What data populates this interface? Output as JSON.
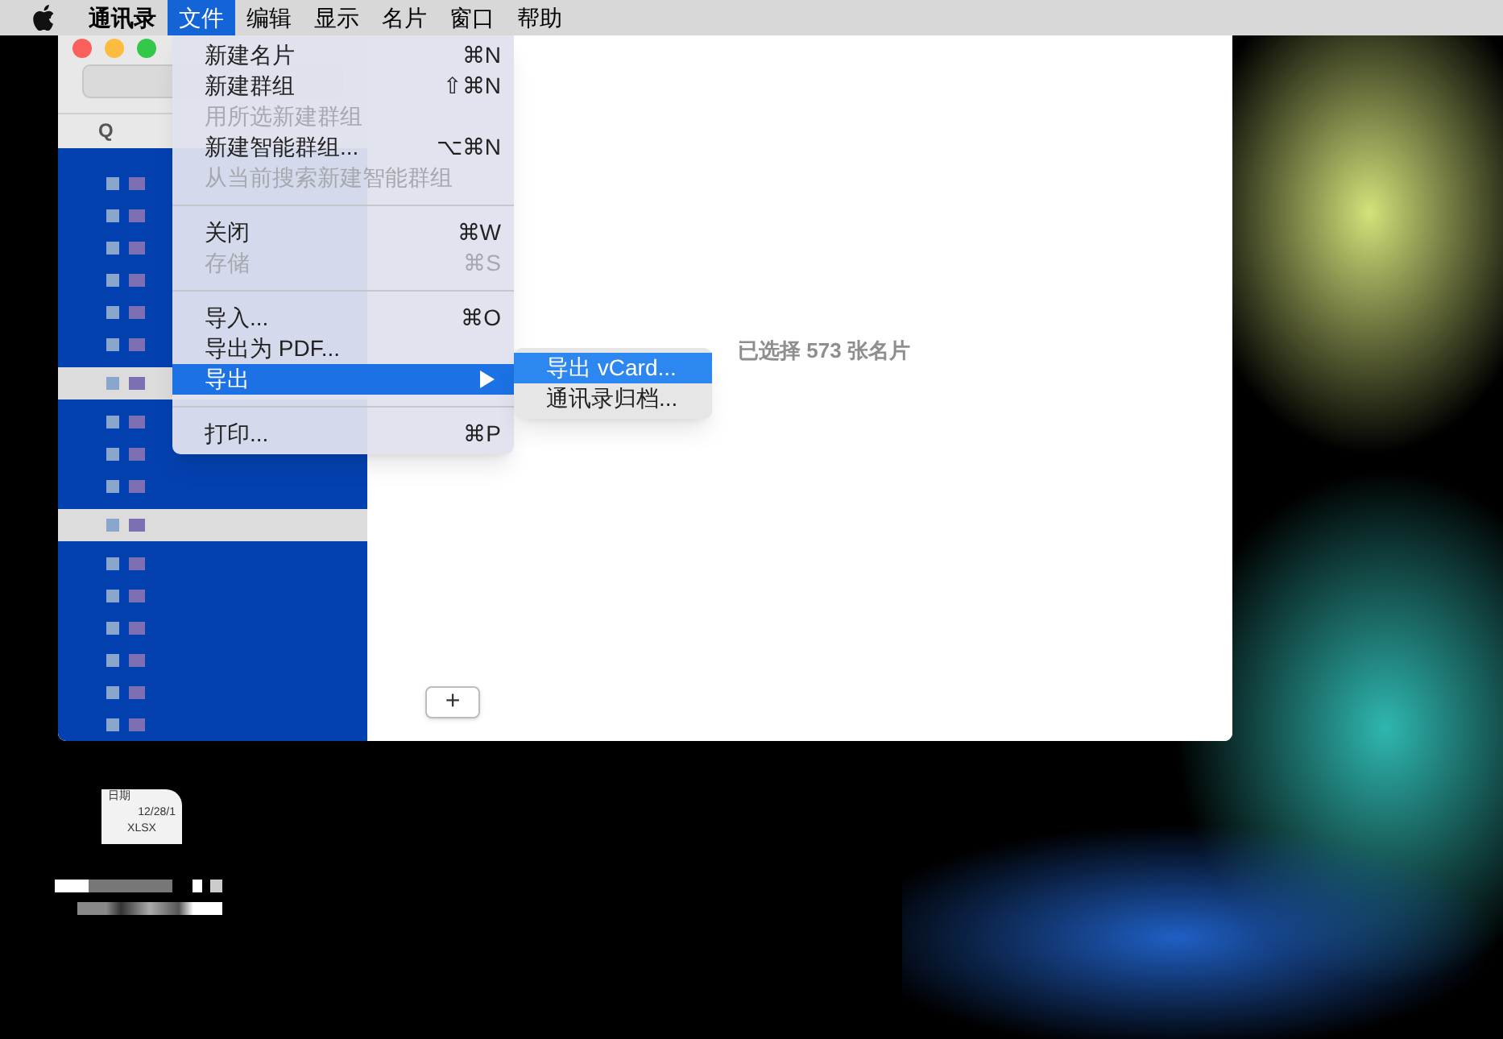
{
  "menu_bar": {
    "items": [
      {
        "label": "通讯录",
        "selected": false,
        "bold": true
      },
      {
        "label": "文件",
        "selected": true,
        "bold": false
      },
      {
        "label": "编辑",
        "selected": false,
        "bold": false
      },
      {
        "label": "显示",
        "selected": false,
        "bold": false
      },
      {
        "label": "名片",
        "selected": false,
        "bold": false
      },
      {
        "label": "窗口",
        "selected": false,
        "bold": false
      },
      {
        "label": "帮助",
        "selected": false,
        "bold": false
      }
    ]
  },
  "file_menu": {
    "items": [
      {
        "kind": "item",
        "label": "新建名片",
        "shortcut": "⌘N",
        "disabled": false,
        "selected": false,
        "submenu": false
      },
      {
        "kind": "item",
        "label": "新建群组",
        "shortcut": "⇧⌘N",
        "disabled": false,
        "selected": false,
        "submenu": false
      },
      {
        "kind": "item",
        "label": "用所选新建群组",
        "disabled": true,
        "selected": false,
        "submenu": false
      },
      {
        "kind": "item",
        "label": "新建智能群组...",
        "shortcut": "⌥⌘N",
        "disabled": false,
        "selected": false,
        "submenu": false
      },
      {
        "kind": "item",
        "label": "从当前搜索新建智能群组",
        "disabled": true,
        "selected": false,
        "submenu": false
      },
      {
        "kind": "separator"
      },
      {
        "kind": "item",
        "label": "关闭",
        "shortcut": "⌘W",
        "disabled": false,
        "selected": false,
        "submenu": false
      },
      {
        "kind": "item",
        "label": "存储",
        "shortcut": "⌘S",
        "disabled": true,
        "selected": false,
        "submenu": false
      },
      {
        "kind": "separator"
      },
      {
        "kind": "item",
        "label": "导入...",
        "shortcut": "⌘O",
        "disabled": false,
        "selected": false,
        "submenu": false
      },
      {
        "kind": "item",
        "label": "导出为 PDF...",
        "disabled": false,
        "selected": false,
        "submenu": false
      },
      {
        "kind": "item",
        "label": "导出",
        "disabled": false,
        "selected": true,
        "submenu": true
      },
      {
        "kind": "separator"
      },
      {
        "kind": "item",
        "label": "打印...",
        "shortcut": "⌘P",
        "disabled": false,
        "selected": false,
        "submenu": false
      }
    ]
  },
  "export_submenu": {
    "items": [
      {
        "label": "导出 vCard...",
        "selected": true
      },
      {
        "label": "通讯录归档...",
        "selected": false
      }
    ]
  },
  "contacts_window": {
    "sidebar": {
      "section_header": "Q"
    },
    "detail": {
      "selection_text": "已选择 573 张名片",
      "add_button": "+"
    }
  },
  "desktop_file": {
    "thumbnail_lines": [
      "日期",
      "12/28/1",
      "XLSX"
    ]
  }
}
